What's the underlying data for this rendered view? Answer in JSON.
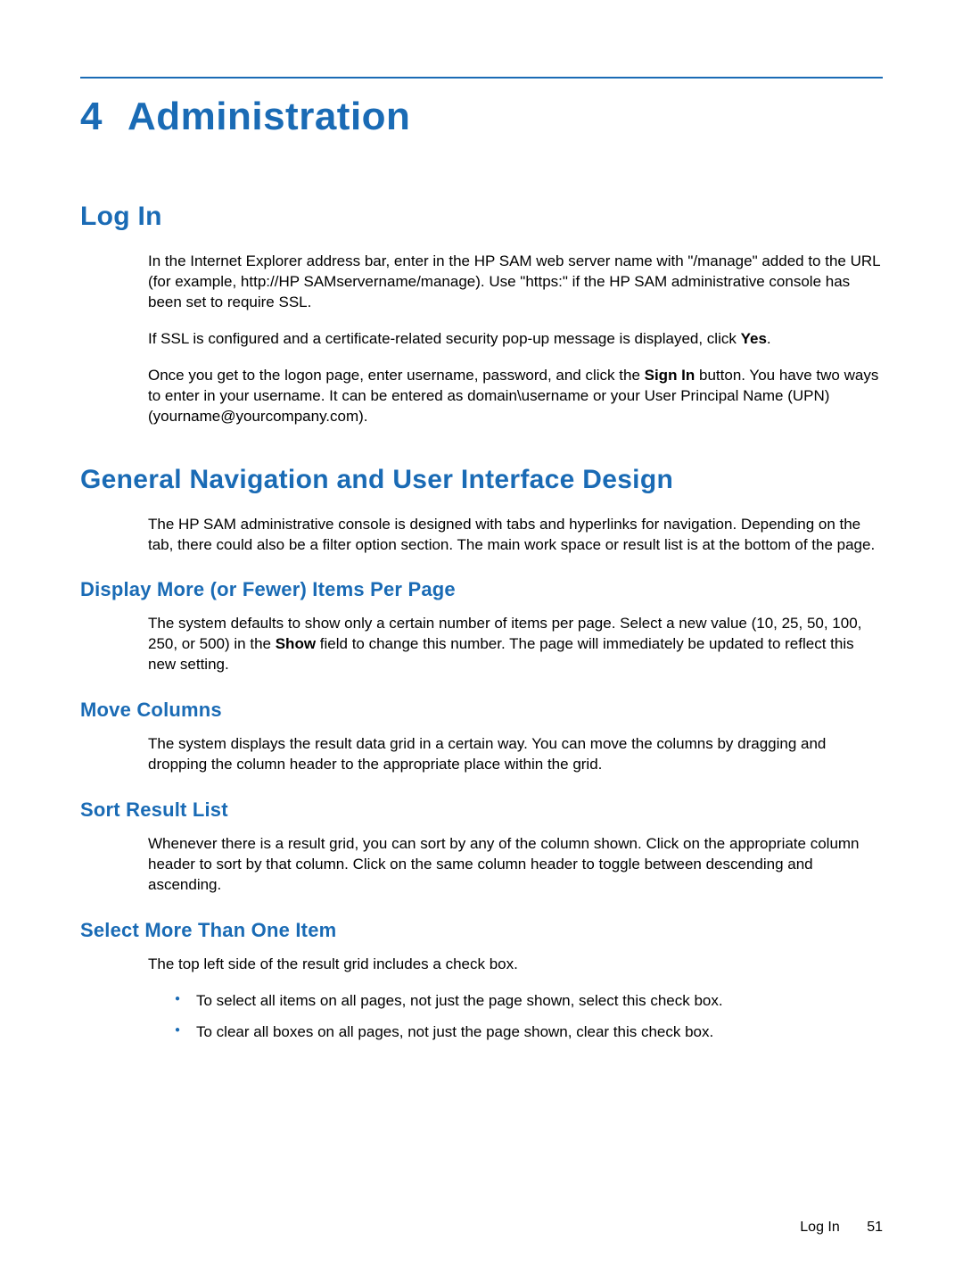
{
  "chapter": {
    "number": "4",
    "title": "Administration"
  },
  "sections": {
    "login": {
      "heading": "Log In",
      "p1a": "In the Internet Explorer address bar, enter in the HP SAM web server name with \"/manage\" added to the URL (for example, http://HP SAMservername/manage). Use \"https:\" if the HP SAM administrative console has been set to require SSL.",
      "p2a": "If SSL is configured and a certificate-related security pop-up message is displayed, click ",
      "p2b": "Yes",
      "p2c": ".",
      "p3a": "Once you get to the logon page, enter username, password, and click the ",
      "p3b": "Sign In",
      "p3c": " button. You have two ways to enter in your username. It can be entered as domain\\username or your User Principal Name (UPN) (yourname@yourcompany.com)."
    },
    "nav": {
      "heading": "General Navigation and User Interface Design",
      "p1": "The HP SAM administrative console is designed with tabs and hyperlinks for navigation. Depending on the tab, there could also be a filter option section. The main work space or result list is at the bottom of the page.",
      "display": {
        "heading": "Display More (or Fewer) Items Per Page",
        "p1a": "The system defaults to show only a certain number of items per page. Select a new value (10, 25, 50, 100, 250, or 500) in the ",
        "p1b": "Show",
        "p1c": " field to change this number. The page will immediately be updated to reflect this new setting."
      },
      "move": {
        "heading": "Move Columns",
        "p1": "The system displays the result data grid in a certain way. You can move the columns by dragging and dropping the column header to the appropriate place within the grid."
      },
      "sort": {
        "heading": "Sort Result List",
        "p1": "Whenever there is a result grid, you can sort by any of the column shown. Click on the appropriate column header to sort by that column. Click on the same column header to toggle between descending and ascending."
      },
      "select": {
        "heading": "Select More Than One Item",
        "p1": "The top left side of the result grid includes a check box.",
        "b1": "To select all items on all pages, not just the page shown, select this check box.",
        "b2": "To clear all boxes on all pages, not just the page shown, clear this check box."
      }
    }
  },
  "footer": {
    "section": "Log In",
    "page": "51"
  }
}
